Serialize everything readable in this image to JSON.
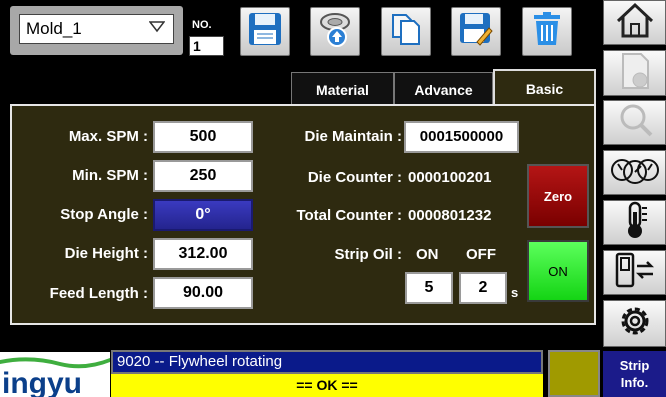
{
  "header": {
    "mold_selected": "Mold_1",
    "no_label": "NO.",
    "no_value": "1"
  },
  "toolbar": {
    "icons": [
      "save-icon",
      "load-icon",
      "copy-icon",
      "save-as-icon",
      "delete-icon"
    ]
  },
  "tabs": [
    {
      "label": "Material",
      "active": false
    },
    {
      "label": "Advance",
      "active": false
    },
    {
      "label": "Basic",
      "active": true
    }
  ],
  "left_fields": [
    {
      "label": "Max. SPM :",
      "value": "500"
    },
    {
      "label": "Min. SPM :",
      "value": "250"
    },
    {
      "label": "Stop Angle :",
      "value": "0°"
    },
    {
      "label": "Die Height :",
      "value": "312.00"
    },
    {
      "label": "Feed Length :",
      "value": "90.00"
    }
  ],
  "right_fields": {
    "die_maintain_label": "Die Maintain :",
    "die_maintain_value": "0001500000",
    "die_counter_label": "Die Counter :",
    "die_counter_value": "0000100201",
    "total_counter_label": "Total Counter :",
    "total_counter_value": "0000801232",
    "strip_oil_label": "Strip Oil :",
    "strip_oil_on_label": "ON",
    "strip_oil_off_label": "OFF",
    "strip_oil_on_value": "5",
    "strip_oil_off_value": "2",
    "strip_oil_unit": "s"
  },
  "buttons": {
    "zero_label": "Zero",
    "on_label": "ON"
  },
  "sidebar": {
    "icons": [
      "home-icon",
      "mold-data-icon",
      "search-icon",
      "gauges-icon",
      "thermometer-icon",
      "switch-icon",
      "gear-icon"
    ],
    "strip_info_line1": "Strip",
    "strip_info_line2": "Info."
  },
  "status": {
    "message": "9020  -- Flywheel rotating",
    "state": "== OK =="
  },
  "logo_text": "ingyu",
  "colors": {
    "panel_bg": "#2e2a10",
    "zero_red": "#9a0a0a",
    "on_green": "#22e022",
    "status_blue": "#0a1a8a",
    "status_yellow": "#ffff00"
  }
}
